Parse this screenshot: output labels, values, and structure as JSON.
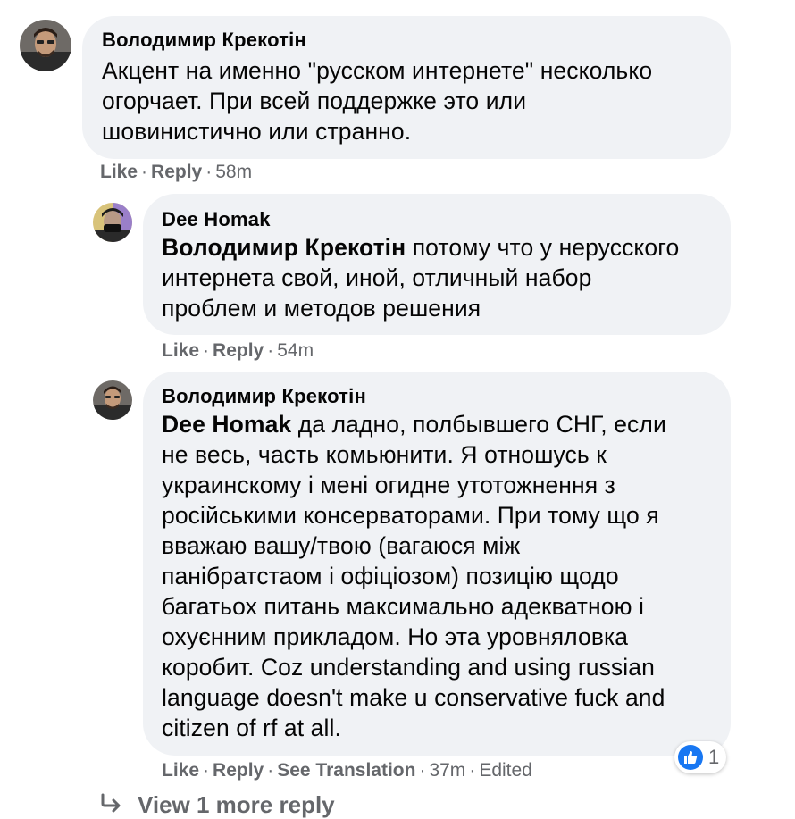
{
  "comments": [
    {
      "author": "Володимир Крекотін",
      "mention": "",
      "text_lines": [
        "Акцент на именно \"русском интернете\" несколько",
        "огорчает. При всей поддержке это или",
        "шовинистично или странно."
      ],
      "like": "Like",
      "reply": "Reply",
      "time": "58m"
    },
    {
      "author": "Dee Homak",
      "mention": "Володимир Крекотін",
      "text_lines": [
        " потому что у нерусского",
        "интернета свой, иной, отличный набор",
        "проблем и методов решения"
      ],
      "like": "Like",
      "reply": "Reply",
      "time": "54m"
    },
    {
      "author": "Володимир Крекотін",
      "mention": "Dee Homak",
      "text_lines": [
        " да ладно, полбывшего СНГ, если",
        "не весь, часть комьюнити. Я отношусь к",
        "украинскому і мені огидне утотожнення з",
        "російськими консерваторами. При тому що я",
        "вважаю вашу/твою (вагаюся між",
        "панібратстаом і офіціозом) позицію щодо",
        "багатьох питань максимально адекватною і",
        "охуєнним прикладом. Но эта уровняловка",
        "коробит. Coz understanding and using russian",
        "language doesn't make u conservative fuck and",
        "citizen of rf at all."
      ],
      "like": "Like",
      "reply": "Reply",
      "see_translation": "See Translation",
      "time": "37m",
      "edited": "Edited",
      "reaction_count": "1"
    }
  ],
  "view_more": "View 1 more reply",
  "icons": {
    "reaction": "thumbs-up-icon",
    "view_more": "reply-arrow-icon"
  },
  "colors": {
    "bubble": "#f0f2f5",
    "meta": "#65676b",
    "like_blue": "#1877f2"
  }
}
